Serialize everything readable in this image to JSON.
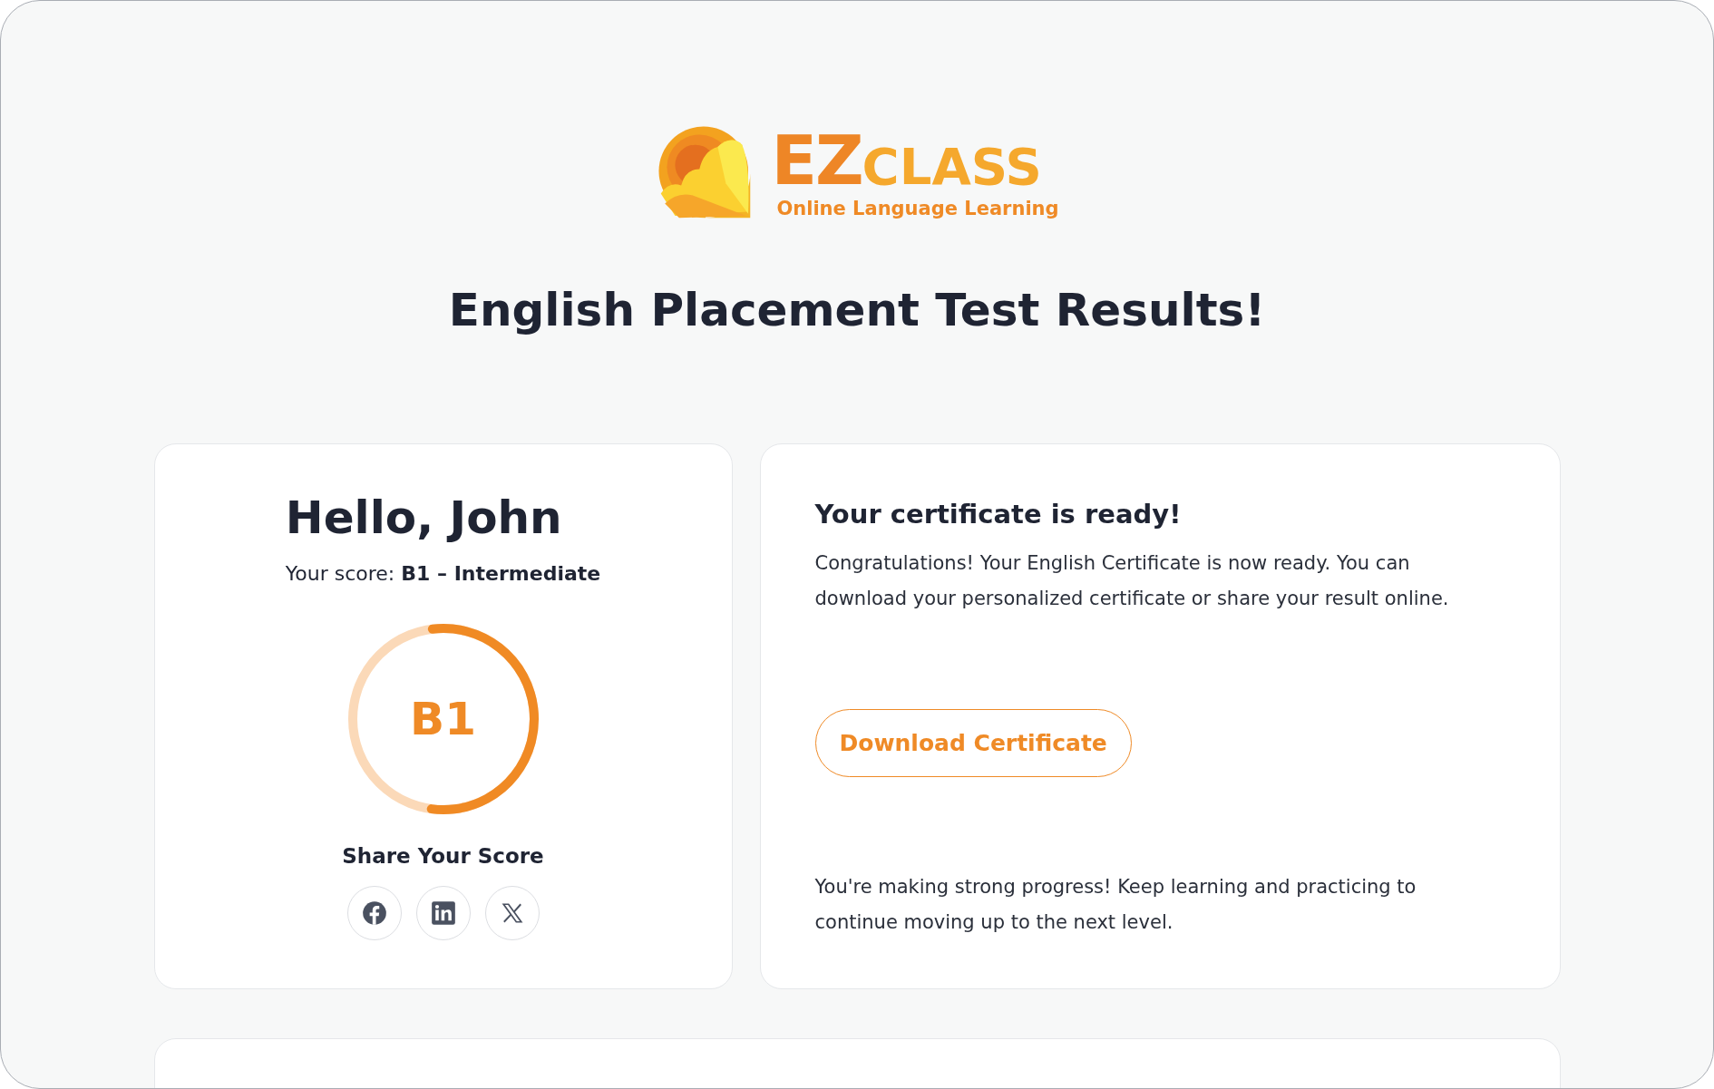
{
  "logo": {
    "brand_primary": "EZ",
    "brand_secondary": "CLASS",
    "tagline": "Online Language Learning"
  },
  "page_title": "English Placement Test Results!",
  "score_card": {
    "greeting": "Hello, John",
    "score_line": "Your score: **B1 – Intermediate**",
    "level_code": "B1",
    "level": 0.54,
    "share_heading": "Share Your Score",
    "share_buttons": [
      {
        "kind": "facebook"
      },
      {
        "kind": "linkedin"
      },
      {
        "kind": "x"
      }
    ]
  },
  "certificate_card": {
    "title": "Your certificate is ready!",
    "message": "Congratulations! Your English Certificate is now ready. You can download your personalized certificate or share your result online.",
    "button": "Download Certificate",
    "footer": "You're making strong progress! Keep learning and practicing to continue moving up to the next level."
  }
}
